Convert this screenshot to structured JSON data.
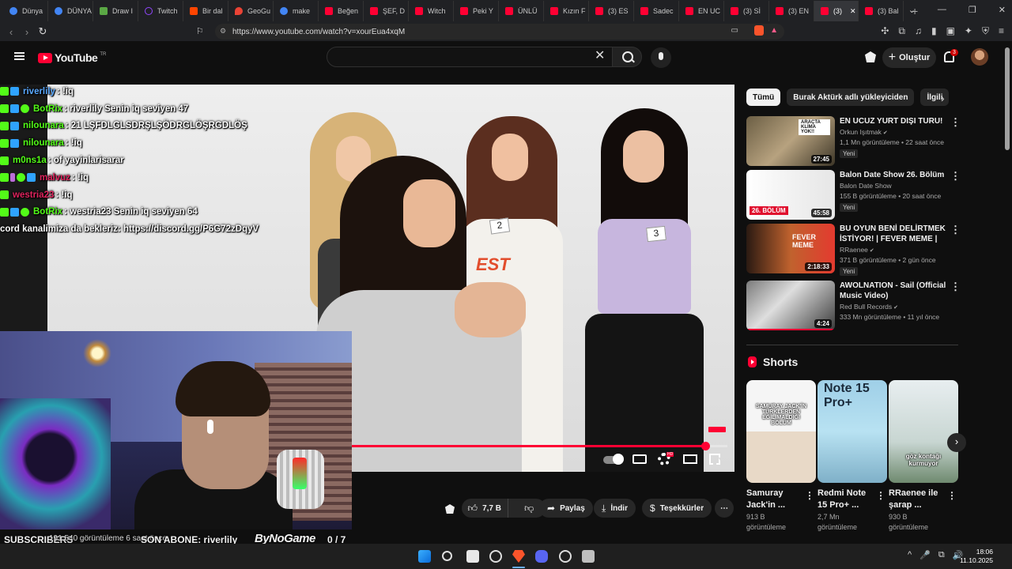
{
  "browser": {
    "tabs": [
      {
        "label": "Dünya",
        "fav": "g"
      },
      {
        "label": "DÜNYA",
        "fav": "g"
      },
      {
        "label": "Draw I",
        "fav": "grn"
      },
      {
        "label": "Twitch",
        "fav": "tw"
      },
      {
        "label": "Bir dal",
        "fav": "red"
      },
      {
        "label": "GeoGu",
        "fav": "pin"
      },
      {
        "label": "make",
        "fav": "g"
      },
      {
        "label": "Beğen",
        "fav": "yt"
      },
      {
        "label": "ŞEF, D",
        "fav": "yt"
      },
      {
        "label": "Witch",
        "fav": "yt"
      },
      {
        "label": "Peki Y",
        "fav": "yt"
      },
      {
        "label": "ÜNLÜ",
        "fav": "yt"
      },
      {
        "label": "Kızın F",
        "fav": "yt"
      },
      {
        "label": "(3) ES",
        "fav": "yt"
      },
      {
        "label": "Sadec",
        "fav": "yt"
      },
      {
        "label": "EN UC",
        "fav": "yt"
      },
      {
        "label": "(3) Sİ",
        "fav": "yt"
      },
      {
        "label": "(3) EN",
        "fav": "yt"
      },
      {
        "label": "(3)",
        "fav": "yt",
        "active": true
      },
      {
        "label": "(3) Bal",
        "fav": "yt"
      }
    ],
    "url": "https://www.youtube.com/watch?v=xourEua4xqM",
    "new_tab": "+",
    "close_tab": "✕"
  },
  "youtube": {
    "logo_text": "YouTube",
    "logo_region": "TR",
    "search_clear": "✕",
    "create_label": "Oluştur",
    "notification_count": "3"
  },
  "chat": [
    {
      "badges": [
        "k",
        "b"
      ],
      "user": "riverlily",
      "color": "#5aa9ff",
      "msg": ": !iq"
    },
    {
      "badges": [
        "k",
        "b",
        "c"
      ],
      "user": "BotRix",
      "color": "#53fc18",
      "msg": ": riverlily Senin iq seviyen 47"
    },
    {
      "badges": [
        "k",
        "b"
      ],
      "user": "nilounara",
      "color": "#53fc18",
      "msg": ": 21 LŞFDLGLSDRŞLŞÖDRGLÖŞRGDLÖŞ"
    },
    {
      "badges": [
        "k",
        "b"
      ],
      "user": "nilounara",
      "color": "#53fc18",
      "msg": ": !iq"
    },
    {
      "badges": [
        "k"
      ],
      "user": "m0ns1a",
      "color": "#53fc18",
      "msg": ": of yayinlarisarar"
    },
    {
      "badges": [
        "k",
        "m",
        "c",
        "b"
      ],
      "user": "malvuz",
      "color": "#e0245e",
      "msg": ": !iq"
    },
    {
      "badges": [
        "k"
      ],
      "user": "westria23",
      "color": "#e0245e",
      "msg": ": !iq"
    },
    {
      "badges": [
        "k",
        "b",
        "c"
      ],
      "user": "BotRix",
      "color": "#53fc18",
      "msg": ": westria23 Senin iq seviyen 64"
    },
    {
      "badges": [],
      "user": "",
      "color": "#fff",
      "msg": "cord kanalimiza da bekleriz: https://discord.gg/P6G72zDqyV"
    }
  ],
  "overlay": {
    "subscribers_label": "SUBSCRIBERS",
    "views_text": "191.540 görüntüleme  6 saat önce",
    "last_sub_label": "SON ABONE: riverlily",
    "brand": "ByNoGame",
    "count": "0  / 7"
  },
  "video": {
    "tag_2": "2",
    "tag_3": "3",
    "shirt_text": "EST",
    "progress": 0.94
  },
  "actions": {
    "likes": "7,7 B",
    "share": "Paylaş",
    "download": "İndir",
    "thanks": "Teşekkürler",
    "more": "⋯"
  },
  "chips": [
    {
      "label": "Tümü",
      "active": true
    },
    {
      "label": "Burak Aktürk adlı yükleyiciden",
      "active": false
    },
    {
      "label": "İlgili",
      "active": false
    }
  ],
  "chip_next": "›",
  "recommendations": [
    {
      "title": "EN UCUZ YURT DIŞI TURU!",
      "channel": "Orkun Işıtmak",
      "meta": "1,1 Mn görüntüleme • 22 saat önce",
      "badge": "Yeni",
      "duration": "27:45",
      "thumb": "t1",
      "thumb_label": "ARAÇTA KLİMA YOK!!"
    },
    {
      "title": "Balon Date Show 26. Bölüm",
      "channel": "Balon Date Show",
      "meta": "155 B görüntüleme • 20 saat önce",
      "badge": "Yeni",
      "duration": "45:58",
      "thumb": "t2",
      "thumb_label": "26. BÖLÜM"
    },
    {
      "title": "BU OYUN BENİ DELİRTMEK İSTİYOR! | FEVER MEME |",
      "channel": "RRaenee",
      "meta": "371 B görüntüleme • 2 gün önce",
      "badge": "Yeni",
      "duration": "2:18:33",
      "thumb": "t3",
      "thumb_label": "FEVER MEME"
    },
    {
      "title": "AWOLNATION - Sail (Official Music Video)",
      "channel": "Red Bull Records",
      "meta": "333 Mn görüntüleme • 11 yıl önce",
      "badge": "",
      "duration": "4:24",
      "thumb": "t4",
      "thumb_label": "",
      "watched": 1.0
    }
  ],
  "shorts": {
    "heading": "Shorts",
    "items": [
      {
        "title": "Samuray Jack'in ...",
        "views": "913 B görüntüleme",
        "thumb_text": "SAMURAY JACK'İN TÜRKLERDEN EĞİLİMALDIĞI BÖLÜM"
      },
      {
        "title": "Redmi Note 15 Pro+ ...",
        "views": "2,7 Mn görüntüleme",
        "thumb_text": "Note 15 Pro+"
      },
      {
        "title": "RRaenee ile şarap ...",
        "views": "930 B görüntüleme",
        "thumb_text": "göz kontağı kurmuyor"
      }
    ],
    "next": "›"
  },
  "taskbar": {
    "time": "18:06",
    "date": "11.10.2025",
    "tray": [
      "^",
      "🎤",
      "⧉",
      "🔊"
    ]
  }
}
